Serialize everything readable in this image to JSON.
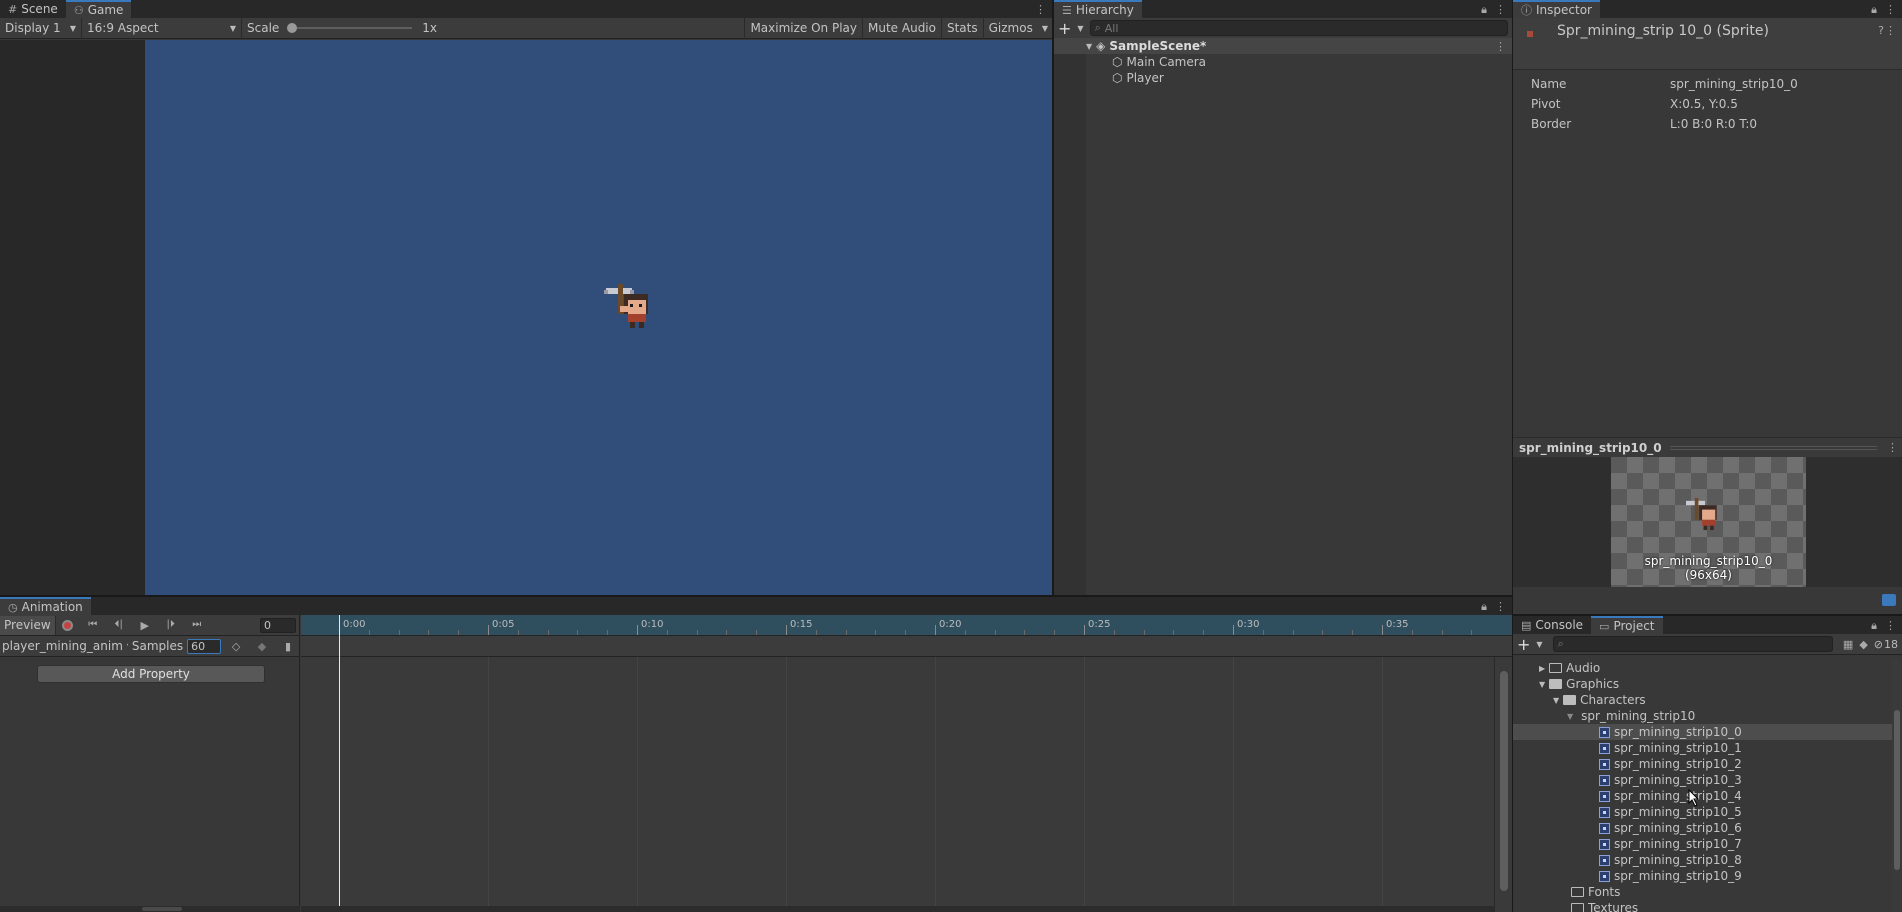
{
  "colors": {
    "game_bg": "#314d79",
    "panel": "#383838",
    "tab_accent": "#3a79bb",
    "record": "#c64242"
  },
  "game": {
    "tabs": [
      {
        "label": "Scene",
        "icon": "grid-icon"
      },
      {
        "label": "Game",
        "icon": "gamepad-icon"
      }
    ],
    "display": "Display 1",
    "aspect": "16:9 Aspect",
    "scale_label": "Scale",
    "scale_value": "1x",
    "maximize": "Maximize On Play",
    "mute": "Mute Audio",
    "stats": "Stats",
    "gizmos": "Gizmos"
  },
  "hierarchy": {
    "tab": "Hierarchy",
    "search_placeholder": "All",
    "scene": "SampleScene*",
    "items": [
      "Main Camera",
      "Player"
    ]
  },
  "inspector": {
    "tab": "Inspector",
    "title": "Spr_mining_strip 10_0 (Sprite)",
    "fields": [
      {
        "label": "Name",
        "value": "spr_mining_strip10_0"
      },
      {
        "label": "Pivot",
        "value": "X:0.5, Y:0.5"
      },
      {
        "label": "Border",
        "value": "L:0 B:0 R:0 T:0"
      }
    ],
    "preview_title": "spr_mining_strip10_0",
    "preview_caption": "spr_mining_strip10_0",
    "preview_size": "(96x64)"
  },
  "animation": {
    "tab": "Animation",
    "preview_label": "Preview",
    "frame": "0",
    "clip": "player_mining_anim",
    "samples_label": "Samples",
    "samples": "60",
    "add_property": "Add Property",
    "ticks": [
      "0:00",
      "0:05",
      "0:10",
      "0:15",
      "0:20",
      "0:25",
      "0:30",
      "0:35"
    ]
  },
  "project": {
    "tabs": [
      "Console",
      "Project"
    ],
    "hidden_count": "18",
    "folders": {
      "audio": "Audio",
      "graphics": "Graphics",
      "characters": "Characters",
      "strip": "spr_mining_strip10",
      "fonts": "Fonts",
      "textures": "Textures"
    },
    "sprites": [
      "spr_mining_strip10_0",
      "spr_mining_strip10_1",
      "spr_mining_strip10_2",
      "spr_mining_strip10_3",
      "spr_mining_strip10_4",
      "spr_mining_strip10_5",
      "spr_mining_strip10_6",
      "spr_mining_strip10_7",
      "spr_mining_strip10_8",
      "spr_mining_strip10_9"
    ]
  }
}
